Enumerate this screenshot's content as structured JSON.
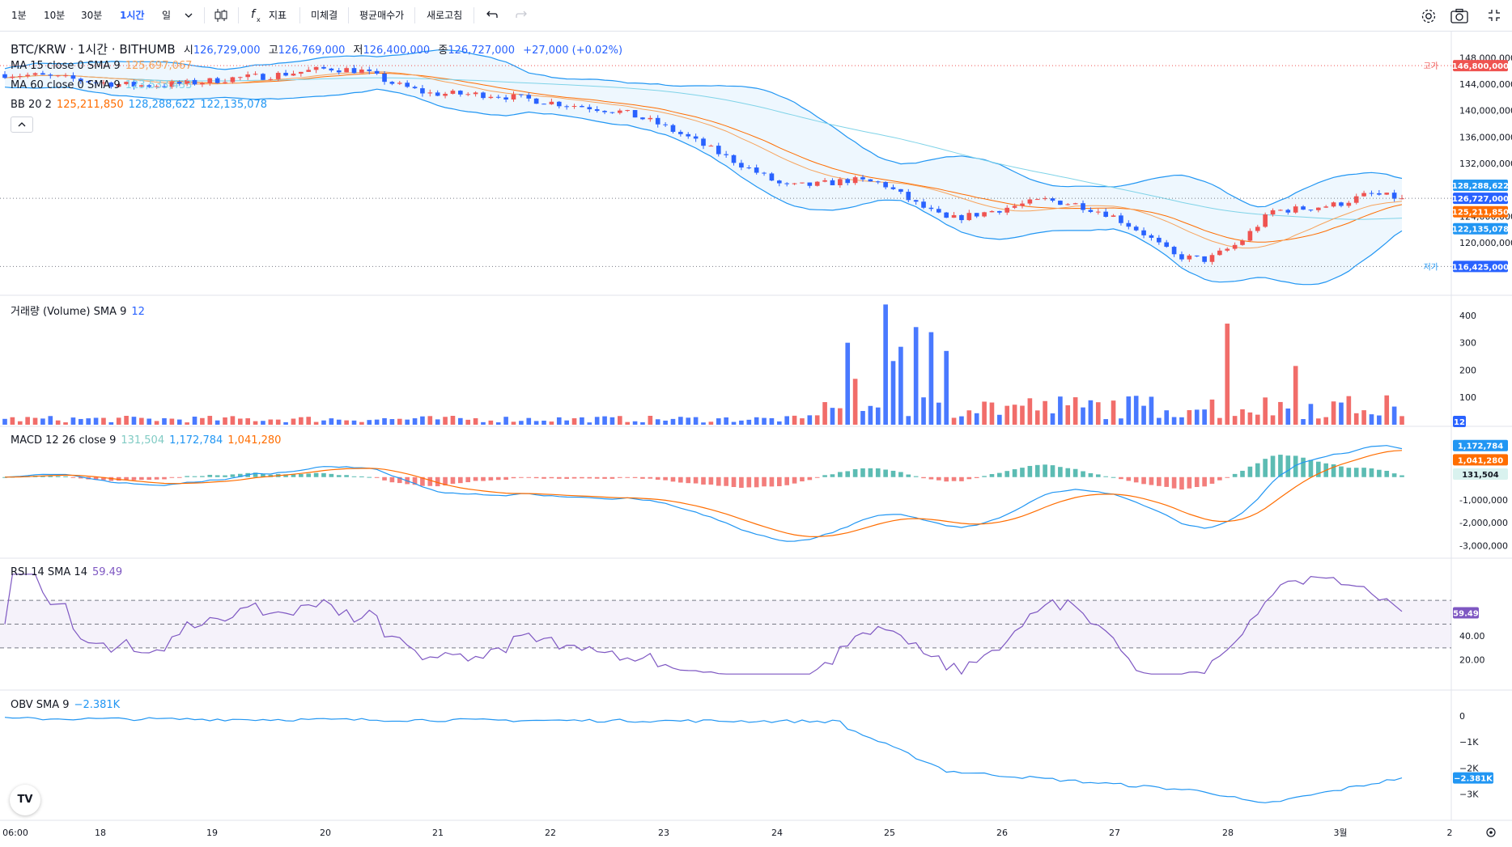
{
  "toolbar": {
    "intervals": [
      "1분",
      "10분",
      "30분",
      "1시간",
      "일"
    ],
    "active_interval": "1시간",
    "indicators_label": "지표",
    "fills_label": "미체결",
    "avg_price_label": "평균매수가",
    "refresh_label": "새로고침",
    "icons": [
      "candle-type-icon",
      "fx-icon",
      "undo-icon",
      "redo-icon",
      "settings-icon",
      "camera-icon",
      "fullscreen-icon"
    ]
  },
  "header": {
    "symbol": "BTC/KRW · 1시간 · BITHUMB",
    "open_label": "시",
    "open": "126,729,000",
    "high_label": "고",
    "high": "126,769,000",
    "low_label": "저",
    "low": "126,400,000",
    "close_label": "종",
    "close": "126,727,000",
    "change": "+27,000 (+0.02%)"
  },
  "legends": {
    "ma15": {
      "label": "MA 15 close 0 SMA 9",
      "value": "125,697,067"
    },
    "ma60": {
      "label": "MA 60 close 0 SMA 9",
      "value": "123,533,433"
    },
    "bb": {
      "label": "BB 20 2",
      "basis": "125,211,850",
      "upper": "128,288,622",
      "lower": "122,135,078"
    },
    "volume": {
      "label": "거래량 (Volume) SMA 9",
      "value": "12"
    },
    "macd": {
      "label": "MACD 12 26 close 9",
      "hist": "131,504",
      "macd": "1,172,784",
      "signal": "1,041,280"
    },
    "rsi": {
      "label": "RSI 14 SMA 14",
      "value": "59.49"
    },
    "obv": {
      "label": "OBV SMA 9",
      "value": "−2.381K"
    }
  },
  "price_axis": {
    "ticks": [
      "148,000,000",
      "144,000,000",
      "140,000,000",
      "136,000,000",
      "132,000,000",
      "124,000,000",
      "120,000,000"
    ],
    "high_marker_label": "고가",
    "high_marker": "146,800,000",
    "low_marker_label": "저가",
    "low_marker": "116,425,000",
    "badges": {
      "upper": "128,288,622",
      "last": "126,727,000",
      "basis": "125,211,850",
      "lower": "122,135,078"
    }
  },
  "volume_axis": {
    "ticks": [
      "400",
      "300",
      "200",
      "100"
    ],
    "badge": "12"
  },
  "macd_axis": {
    "ticks": [
      "-1,000,000",
      "-2,000,000",
      "-3,000,000"
    ],
    "badges": [
      "1,172,784",
      "1,041,280",
      "131,504"
    ]
  },
  "rsi_axis": {
    "ticks": [
      "40.00",
      "20.00"
    ],
    "badge": "59.49"
  },
  "obv_axis": {
    "ticks": [
      "0",
      "−1K",
      "−2K",
      "−3K"
    ],
    "badge": "−2.381K"
  },
  "time_axis": {
    "labels": [
      "06:00",
      "18",
      "19",
      "20",
      "21",
      "22",
      "23",
      "24",
      "25",
      "26",
      "27",
      "28",
      "3월",
      "2"
    ]
  },
  "colors": {
    "up": "#ef5350",
    "down": "#2962ff",
    "ma15": "#f7a35c",
    "ma60": "#7fd3e8",
    "bb": "#2196f3",
    "bb_basis": "#ff6d00",
    "macd": "#2196f3",
    "signal": "#ff6d00",
    "rsi": "#7e57c2",
    "obv": "#2196f3",
    "hist_pos": "#26a69a",
    "hist_neg": "#ef5350"
  },
  "chart_data": {
    "type": "candlestick",
    "symbol": "BTC/KRW",
    "interval": "1시간",
    "x": [
      "06:00",
      "18",
      "19",
      "20",
      "21",
      "22",
      "23",
      "24",
      "25",
      "26",
      "27",
      "28",
      "3월",
      "2"
    ],
    "price_close_path": [
      145500000,
      145300000,
      144800000,
      144200000,
      143800000,
      143900000,
      144300000,
      144900000,
      145200000,
      145800000,
      146400000,
      146000000,
      144000000,
      142600000,
      142500000,
      142400000,
      141800000,
      141100000,
      140500000,
      139800000,
      138200000,
      136000000,
      133500000,
      131000000,
      128500000,
      128800000,
      129500000,
      129000000,
      126000000,
      123500000,
      124400000,
      125500000,
      126500000,
      125800000,
      124300000,
      121600000,
      118000000,
      117400000,
      120000000,
      124800000,
      125200000,
      125800000,
      127400000,
      126727000
    ],
    "ylim": [
      115000000,
      150000000
    ],
    "volume": {
      "last": 12,
      "ylim": [
        0,
        450
      ],
      "peaks": [
        300,
        440,
        270,
        380,
        215
      ]
    },
    "macd": {
      "macd": 1172784,
      "signal": 1041280,
      "hist": 131504,
      "ylim": [
        -3200000,
        1800000
      ]
    },
    "rsi": {
      "value": 59.49,
      "bands": [
        30,
        50,
        70
      ],
      "ylim": [
        0,
        100
      ]
    },
    "obv": {
      "value": -2381,
      "ylim": [
        -3700,
        500
      ]
    }
  }
}
